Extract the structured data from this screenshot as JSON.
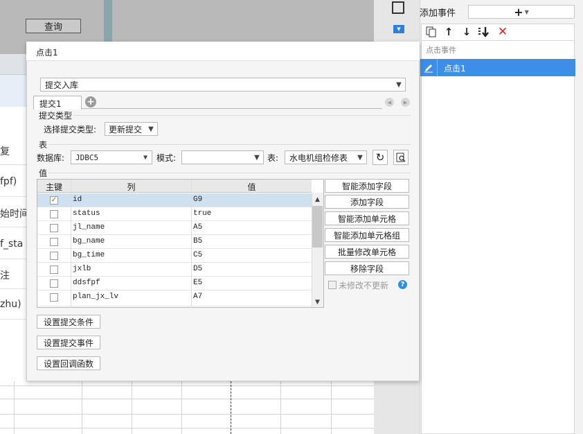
{
  "background": {
    "query_button": "查询",
    "row_fragments": [
      "复",
      "fpf)",
      "始时间",
      "f_sta",
      "注",
      "zhu)"
    ]
  },
  "right_panel": {
    "title": "添加事件",
    "add_label": "+",
    "group_label": "点击事件",
    "event_item": "点击1",
    "toolbar_icons": [
      "copy-icon",
      "arrow-up-icon",
      "arrow-down-icon",
      "move-bottom-icon",
      "delete-icon"
    ]
  },
  "dialog": {
    "title": "点击1",
    "action_select": "提交入库",
    "tab_label": "提交1",
    "submit_type_section": "提交类型",
    "choose_type_label": "选择提交类型:",
    "submit_type_value": "更新提交",
    "table_section": "表",
    "database_label": "数据库:",
    "database_value": "JDBC5",
    "mode_label": "模式:",
    "mode_value": "",
    "table_label": "表:",
    "table_value": "水电机组检修表",
    "value_section": "值",
    "grid": {
      "columns": [
        "主键",
        "列",
        "值"
      ],
      "rows": [
        {
          "key": true,
          "column": "id",
          "value": "G9"
        },
        {
          "key": false,
          "column": "status",
          "value": "true"
        },
        {
          "key": false,
          "column": "jl_name",
          "value": "A5"
        },
        {
          "key": false,
          "column": "bg_name",
          "value": "B5"
        },
        {
          "key": false,
          "column": "bg_time",
          "value": "C5"
        },
        {
          "key": false,
          "column": "jxlb",
          "value": "D5"
        },
        {
          "key": false,
          "column": "ddsfpf",
          "value": "E5"
        },
        {
          "key": false,
          "column": "plan_jx_lv",
          "value": "A7"
        }
      ]
    },
    "side_buttons": [
      "智能添加字段",
      "添加字段",
      "智能添加单元格",
      "智能添加单元格组",
      "批量修改单元格",
      "移除字段"
    ],
    "no_change_label": "未修改不更新",
    "bottom_buttons": [
      "设置提交条件",
      "设置提交事件",
      "设置回调函数"
    ]
  },
  "colors": {
    "accent": "#3d8ee6",
    "delete": "#e02020"
  }
}
